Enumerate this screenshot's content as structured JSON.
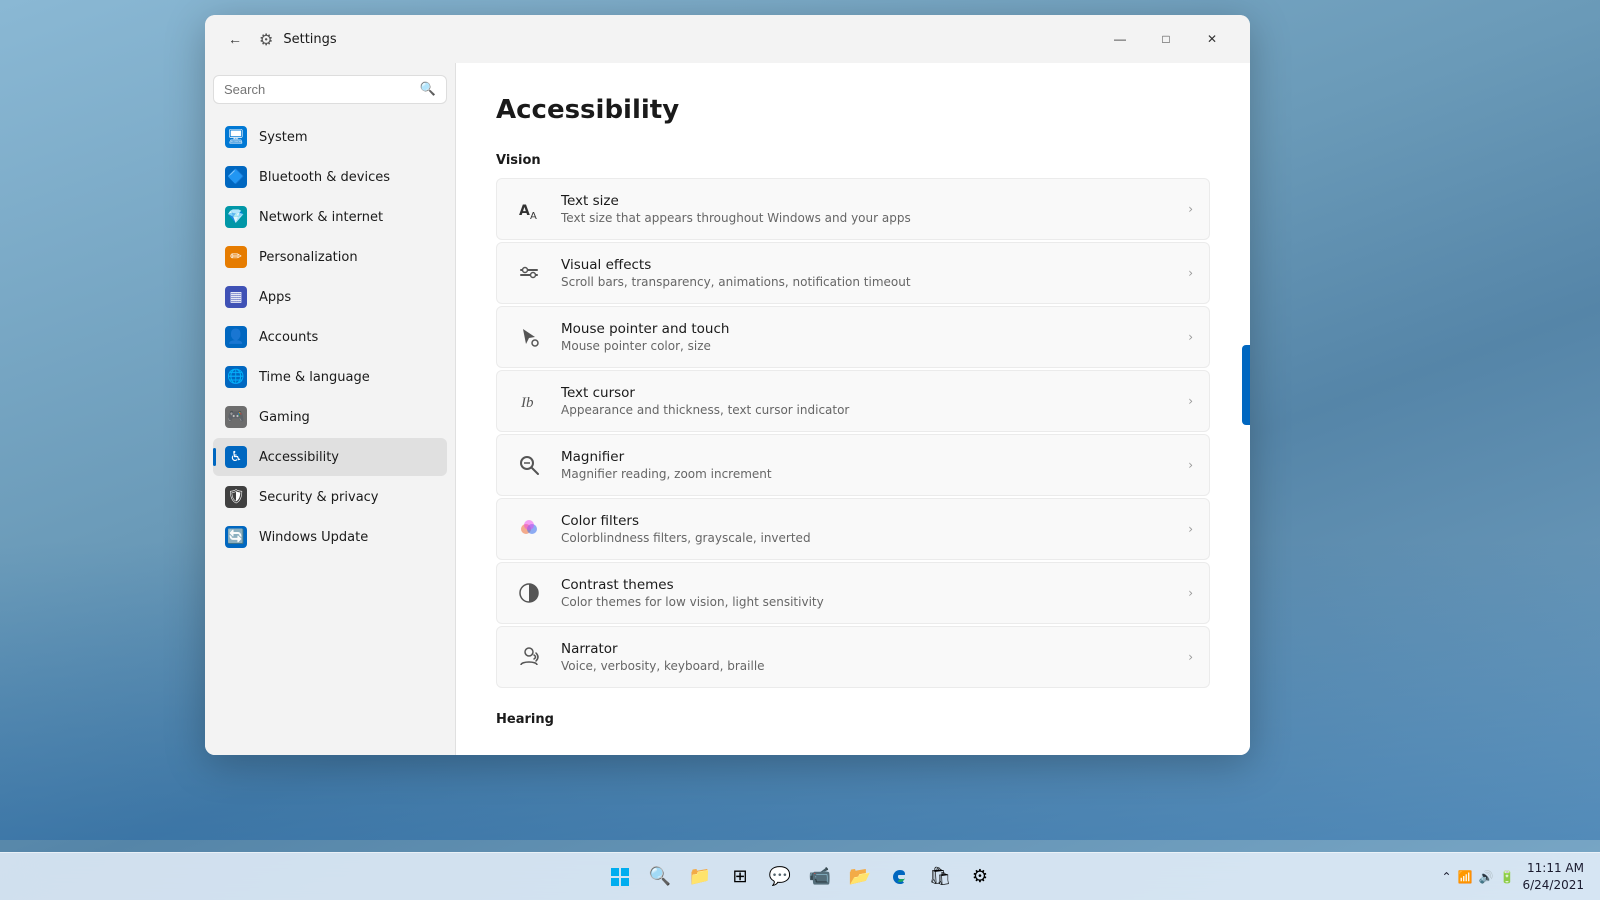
{
  "window": {
    "title": "Settings",
    "back_btn": "←",
    "min_btn": "—",
    "max_btn": "□",
    "close_btn": "✕"
  },
  "search": {
    "placeholder": "Search"
  },
  "page": {
    "title": "Accessibility"
  },
  "nav_items": [
    {
      "id": "system",
      "label": "System",
      "icon": "🖥",
      "color": "blue"
    },
    {
      "id": "bluetooth",
      "label": "Bluetooth & devices",
      "icon": "🔷",
      "color": "blue2"
    },
    {
      "id": "network",
      "label": "Network & internet",
      "icon": "💎",
      "color": "teal"
    },
    {
      "id": "personalization",
      "label": "Personalization",
      "icon": "✏️",
      "color": "orange"
    },
    {
      "id": "apps",
      "label": "Apps",
      "icon": "▦",
      "color": "indigo"
    },
    {
      "id": "accounts",
      "label": "Accounts",
      "icon": "👤",
      "color": "blue2"
    },
    {
      "id": "time",
      "label": "Time & language",
      "icon": "🌐",
      "color": "blue2"
    },
    {
      "id": "gaming",
      "label": "Gaming",
      "icon": "🎮",
      "color": "gray"
    },
    {
      "id": "accessibility",
      "label": "Accessibility",
      "icon": "♿",
      "color": "blue2",
      "active": true
    },
    {
      "id": "security",
      "label": "Security & privacy",
      "icon": "🛡",
      "color": "shield"
    },
    {
      "id": "update",
      "label": "Windows Update",
      "icon": "🔄",
      "color": "update"
    }
  ],
  "vision_section": {
    "label": "Vision",
    "items": [
      {
        "id": "text-size",
        "title": "Text size",
        "desc": "Text size that appears throughout Windows and your apps",
        "icon": "🔤"
      },
      {
        "id": "visual-effects",
        "title": "Visual effects",
        "desc": "Scroll bars, transparency, animations, notification timeout",
        "icon": "✨"
      },
      {
        "id": "mouse-pointer",
        "title": "Mouse pointer and touch",
        "desc": "Mouse pointer color, size",
        "icon": "🖱"
      },
      {
        "id": "text-cursor",
        "title": "Text cursor",
        "desc": "Appearance and thickness, text cursor indicator",
        "icon": "Ꭵ"
      },
      {
        "id": "magnifier",
        "title": "Magnifier",
        "desc": "Magnifier reading, zoom increment",
        "icon": "🔍"
      },
      {
        "id": "color-filters",
        "title": "Color filters",
        "desc": "Colorblindness filters, grayscale, inverted",
        "icon": "🎨"
      },
      {
        "id": "contrast-themes",
        "title": "Contrast themes",
        "desc": "Color themes for low vision, light sensitivity",
        "icon": "◑"
      },
      {
        "id": "narrator",
        "title": "Narrator",
        "desc": "Voice, verbosity, keyboard, braille",
        "icon": "🔊"
      }
    ]
  },
  "hearing_section": {
    "label": "Hearing"
  },
  "taskbar": {
    "time": "11:11 AM",
    "date": "6/24/2021"
  }
}
